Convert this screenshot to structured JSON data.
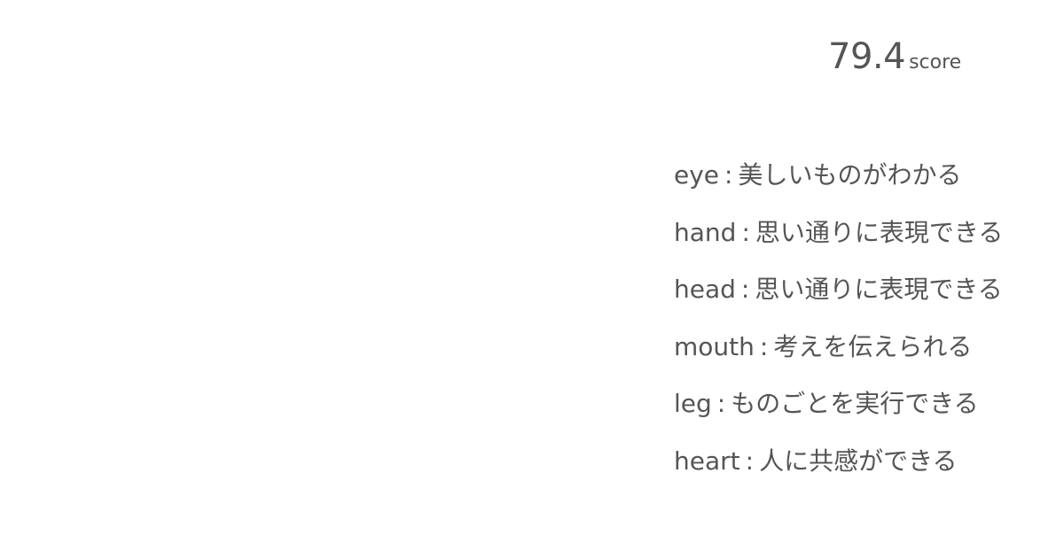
{
  "score": {
    "value": "79.4",
    "unit": "score"
  },
  "traits": [
    {
      "part": "eye",
      "sep": ":",
      "text": "美しいものがわかる"
    },
    {
      "part": "hand",
      "sep": ":",
      "text": "思い通りに表現できる"
    },
    {
      "part": "head",
      "sep": ":",
      "text": "思い通りに表現できる"
    },
    {
      "part": "mouth",
      "sep": ":",
      "text": "考えを伝えられる"
    },
    {
      "part": "leg",
      "sep": ":",
      "text": "ものごとを実行できる"
    },
    {
      "part": "heart",
      "sep": ":",
      "text": "人に共感ができる"
    }
  ]
}
